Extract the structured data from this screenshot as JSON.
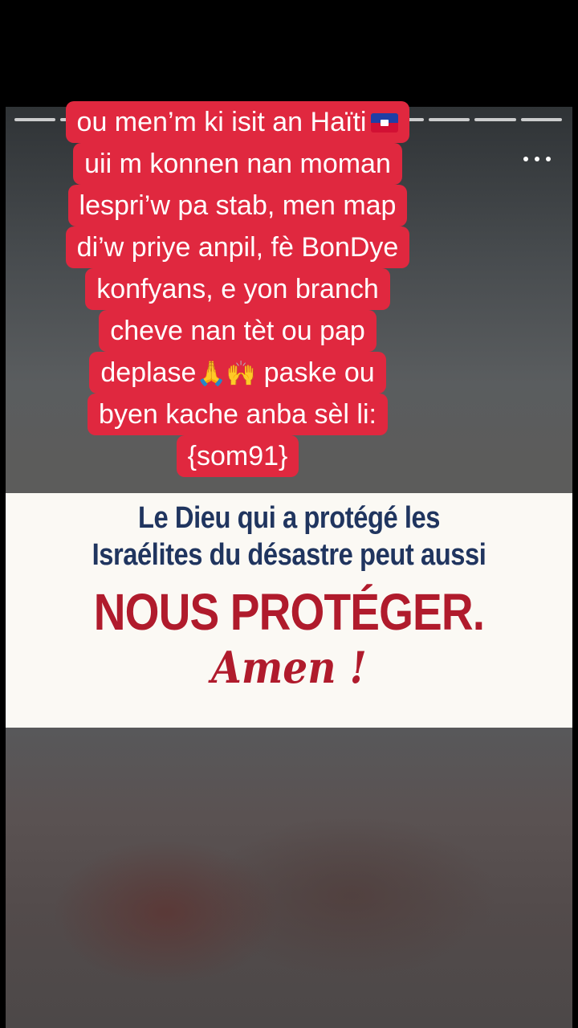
{
  "story": {
    "segments_count": 12,
    "caption_lines": [
      "ou men’m ki isit an Haïti",
      "uii m konnen nan moman",
      "lespri’w pa stab, men map",
      "di’w priye anpil, fè BonDye",
      "konfyans, e yon branch",
      "cheve nan tèt ou pap",
      "deplase",
      "paske ou",
      "byen kache anba sèl li:",
      "{som91}"
    ],
    "emoji_pray": "🙏🙌"
  },
  "card": {
    "line1": "Le Dieu qui a protégé les",
    "line2": "Israélites du désastre peut aussi",
    "headline": "NOUS PROTÉGER.",
    "amen": "Amen !"
  },
  "colors": {
    "caption_bg": "#e0283f",
    "card_blue": "#20355f",
    "card_red": "#b01b2c"
  },
  "icons": [
    "more-options-icon",
    "haiti-flag-icon"
  ]
}
